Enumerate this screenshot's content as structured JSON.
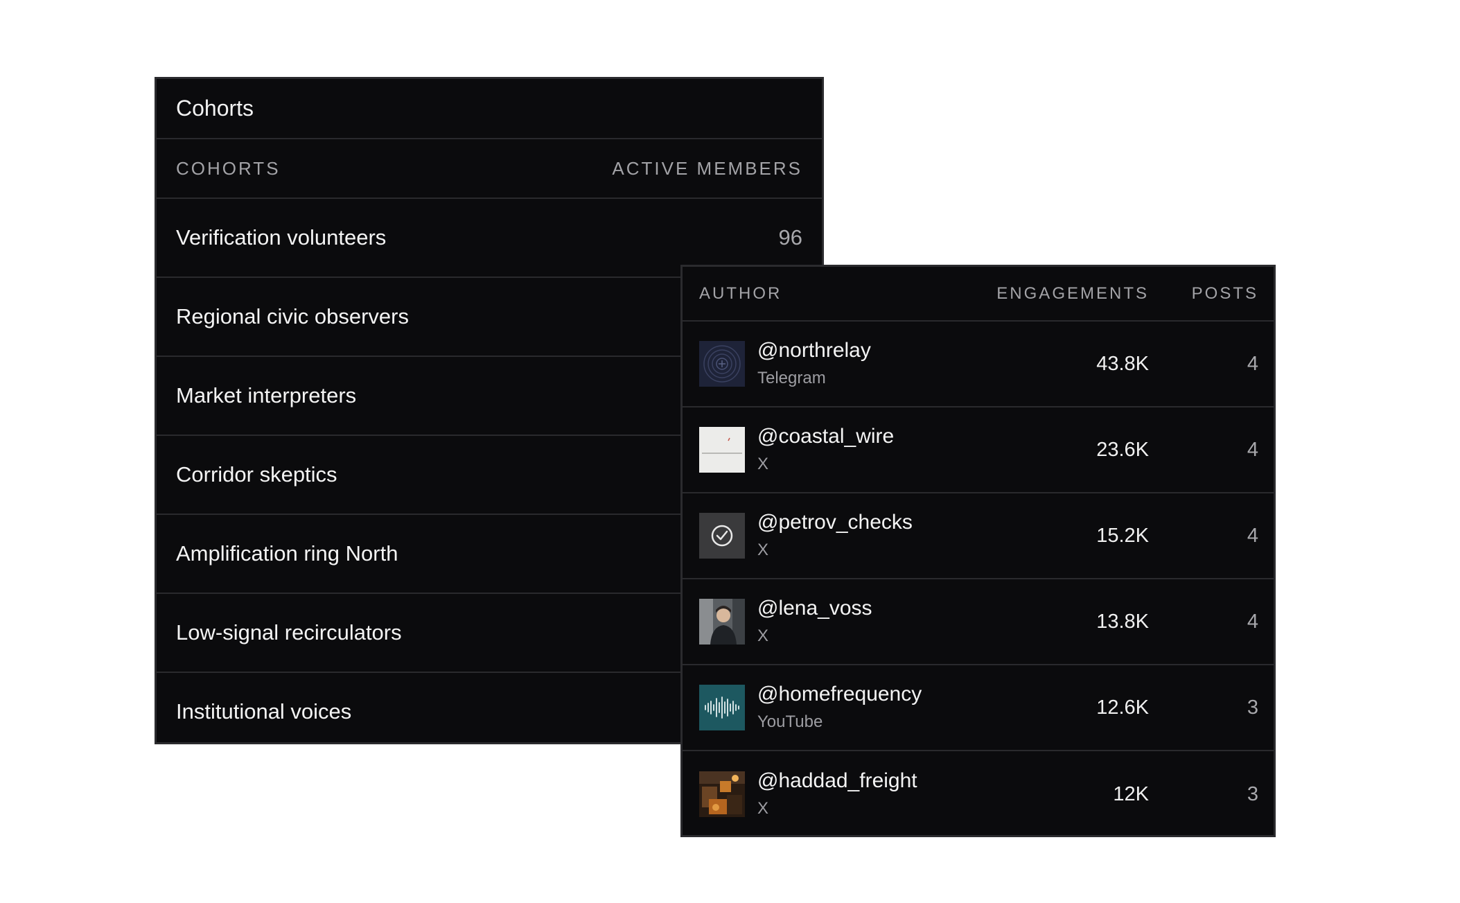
{
  "cohorts": {
    "title": "Cohorts",
    "header": {
      "name": "COHORTS",
      "count": "ACTIVE MEMBERS"
    },
    "rows": [
      {
        "name": "Verification volunteers",
        "count": "96"
      },
      {
        "name": "Regional civic observers",
        "count": ""
      },
      {
        "name": "Market interpreters",
        "count": ""
      },
      {
        "name": "Corridor skeptics",
        "count": ""
      },
      {
        "name": "Amplification ring North",
        "count": ""
      },
      {
        "name": "Low-signal recirculators",
        "count": ""
      },
      {
        "name": "Institutional voices",
        "count": ""
      }
    ]
  },
  "authors": {
    "header": {
      "author": "AUTHOR",
      "engagements": "ENGAGEMENTS",
      "posts": "POSTS"
    },
    "rows": [
      {
        "handle": "@northrelay",
        "platform": "Telegram",
        "engagements": "43.8K",
        "posts": "4",
        "avatar": "concentric-rings-avatar"
      },
      {
        "handle": "@coastal_wire",
        "platform": "X",
        "engagements": "23.6K",
        "posts": "4",
        "avatar": "horizon-sketch-avatar"
      },
      {
        "handle": "@petrov_checks",
        "platform": "X",
        "engagements": "15.2K",
        "posts": "4",
        "avatar": "checkmark-avatar"
      },
      {
        "handle": "@lena_voss",
        "platform": "X",
        "engagements": "13.8K",
        "posts": "4",
        "avatar": "portrait-photo-avatar"
      },
      {
        "handle": "@homefrequency",
        "platform": "YouTube",
        "engagements": "12.6K",
        "posts": "3",
        "avatar": "waveform-avatar"
      },
      {
        "handle": "@haddad_freight",
        "platform": "X",
        "engagements": "12K",
        "posts": "3",
        "avatar": "warehouse-photo-avatar"
      }
    ]
  }
}
